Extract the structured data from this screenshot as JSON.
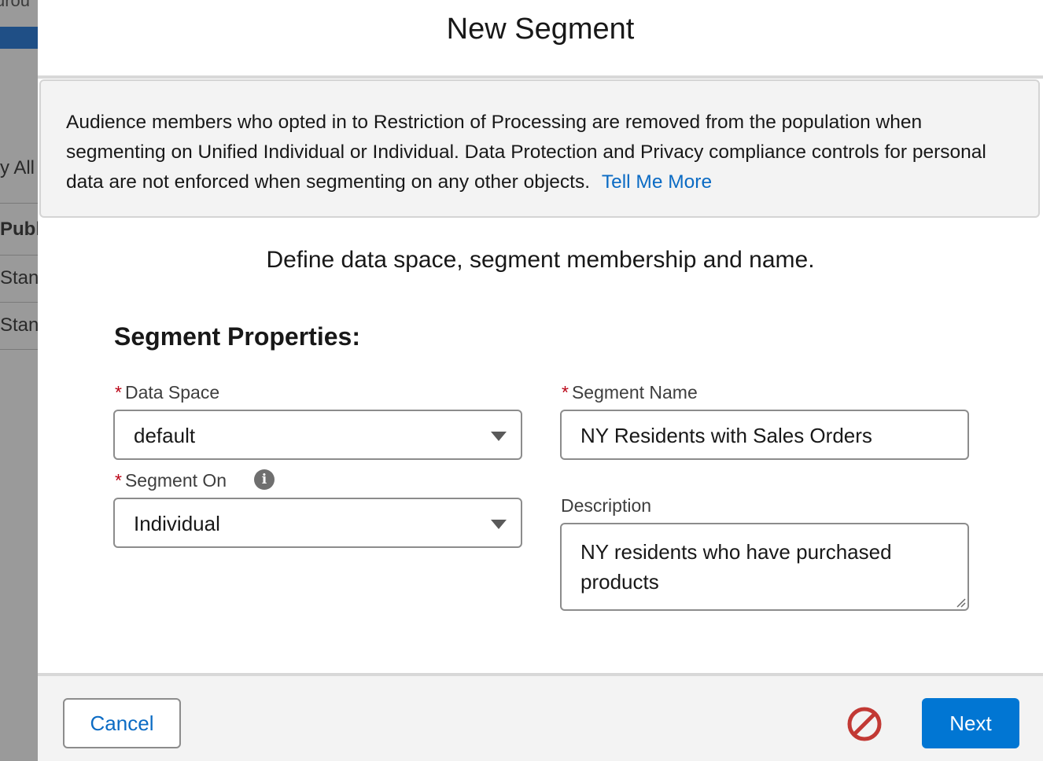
{
  "background": {
    "top_text": "urou",
    "rows": [
      "y All",
      "Publ",
      "Stan",
      "Stan"
    ]
  },
  "modal": {
    "title": "New Segment",
    "notice": {
      "text": "Audience members who opted in to Restriction of Processing are removed from the population when segmenting on Unified Individual or Individual. Data Protection and Privacy compliance controls for personal data are not enforced when segmenting on any other objects.",
      "link": "Tell Me More"
    },
    "subtitle": "Define data space, segment membership and name.",
    "section_title": "Segment Properties:",
    "fields": {
      "data_space": {
        "label": "Data Space",
        "required": "*",
        "value": "default"
      },
      "segment_on": {
        "label": "Segment On",
        "required": "*",
        "value": "Individual",
        "info_icon": "i"
      },
      "segment_name": {
        "label": "Segment Name",
        "required": "*",
        "value": "NY Residents with Sales Orders"
      },
      "description": {
        "label": "Description",
        "value": "NY residents who have purchased products"
      }
    },
    "footer": {
      "cancel_label": "Cancel",
      "next_label": "Next",
      "status_icon": "prohibited-icon",
      "status_color": "#c23934"
    }
  },
  "colors": {
    "link": "#0b6bc4",
    "brand": "#0176d3",
    "required": "#ba0517"
  }
}
